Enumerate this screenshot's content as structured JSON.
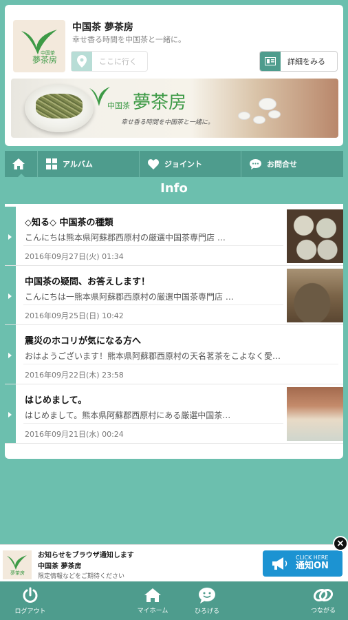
{
  "header": {
    "logo_small_text": "中国茶",
    "logo_big_text": "夢茶房",
    "shop_name": "中国茶 夢茶房",
    "tagline": "幸せ香る時間を中国茶と一緒に。",
    "goto_label": "ここに行く",
    "detail_label": "詳細をみる",
    "banner_small": "中国茶",
    "banner_big": "夢茶房",
    "banner_sub": "幸せ香る時間を中国茶と一緒に。"
  },
  "nav": {
    "items": [
      {
        "label": "",
        "icon": "home-icon"
      },
      {
        "label": "アルバム",
        "icon": "album-icon"
      },
      {
        "label": "ジョイント",
        "icon": "heart-icon"
      },
      {
        "label": "お問合せ",
        "icon": "chat-icon"
      }
    ]
  },
  "section_title": "Info",
  "posts": [
    {
      "title": "◇知る◇ 中国茶の種類",
      "body": "こんにちは熊本県阿蘇郡西原村の厳選中国茶専門店 …",
      "date": "2016年09月27日(火) 01:34",
      "thumb": "tea-leaves"
    },
    {
      "title": "中国茶の疑問、お答えします！",
      "body": "こんにちは一熊本県阿蘇郡西原村の厳選中国茶専門店 …",
      "date": "2016年09月25日(日) 10:42",
      "thumb": "teapot"
    },
    {
      "title": "震災のホコリが気になる方へ",
      "body": "おはようございます！熊本県阿蘇郡西原村の天名茗茶をこよなく愛…",
      "date": "2016年09月22日(木) 23:58",
      "thumb": ""
    },
    {
      "title": "はじめまして。",
      "body": "はじめまして。熊本県阿蘇郡西原村にある厳選中国茶…",
      "date": "2016年09月21日(水) 00:24",
      "thumb": "tea-ceremony"
    }
  ],
  "notify": {
    "line1": "お知らせをブラウザ通知します",
    "line2": "中国茶 夢茶房",
    "line3": "限定情報などをご期待ください",
    "btn_small": "CLICK HERE",
    "btn_big": "通知ON",
    "close": "×"
  },
  "tabbar": {
    "logout": "ログアウト",
    "myhome": "マイホーム",
    "hiroberu": "ひろげる",
    "tsunagaru": "つながる"
  },
  "colors": {
    "accent": "#6cbfae",
    "accent_dark": "#4e9c8d",
    "brand_green": "#3d9a46",
    "notify_blue": "#1c93d2"
  }
}
